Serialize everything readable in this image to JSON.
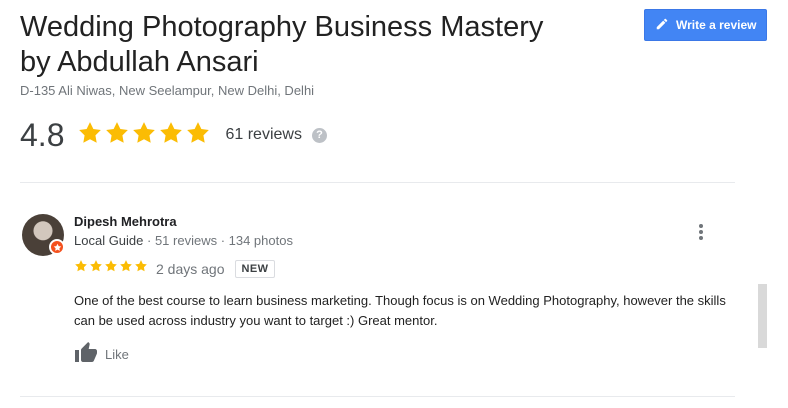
{
  "business": {
    "title": "Wedding Photography Business Mastery by Abdullah Ansari",
    "address": "D-135 Ali Niwas, New Seelampur, New Delhi, Delhi",
    "rating": "4.8",
    "stars": 5,
    "review_count": "61 reviews",
    "help_icon": "?"
  },
  "toolbar": {
    "write_review_label": "Write a review",
    "write_icon": "pencil-icon"
  },
  "review": {
    "reviewer_name": "Dipesh Mehrotra",
    "guide_label": "Local Guide",
    "meta": " · 51 reviews · 134 photos",
    "stars": 5,
    "date": "2 days ago",
    "badge": "NEW",
    "text": "One of the best course to learn business marketing. Though focus is on Wedding Photography, however the skills can be used across industry you want to target :) Great mentor.",
    "like_label": "Like"
  },
  "colors": {
    "accent": "#4285f4",
    "star": "#fbbc04",
    "badge": "#f4511e"
  }
}
